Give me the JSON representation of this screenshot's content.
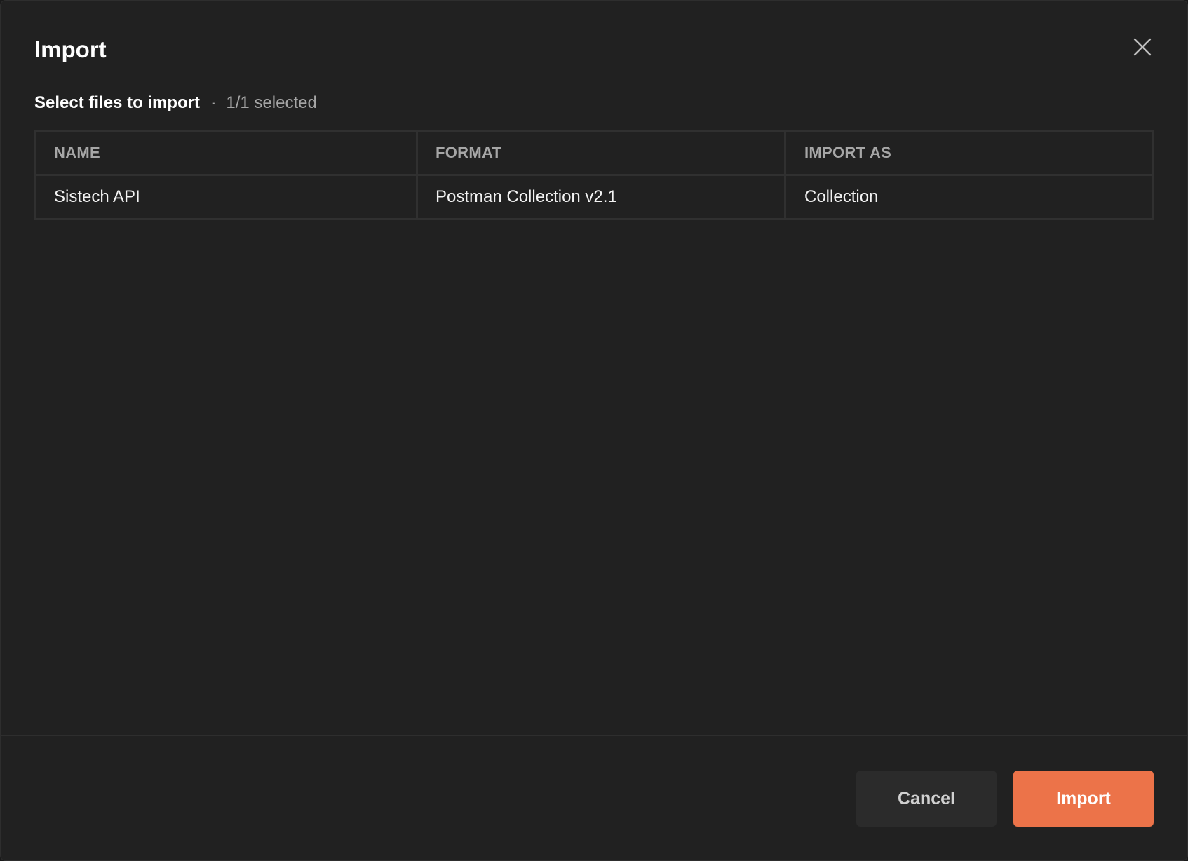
{
  "dialog": {
    "title": "Import",
    "close_icon": "close-icon"
  },
  "selection": {
    "label": "Select files to import",
    "separator": "·",
    "count_text": "1/1 selected"
  },
  "table": {
    "columns": [
      "NAME",
      "FORMAT",
      "IMPORT AS"
    ],
    "rows": [
      {
        "name": "Sistech API",
        "format": "Postman Collection v2.1",
        "import_as": "Collection"
      }
    ]
  },
  "footer": {
    "cancel_label": "Cancel",
    "import_label": "Import"
  },
  "colors": {
    "background": "#212121",
    "accent": "#ec7349",
    "border": "#303030",
    "muted_text": "#a6a6a6"
  }
}
